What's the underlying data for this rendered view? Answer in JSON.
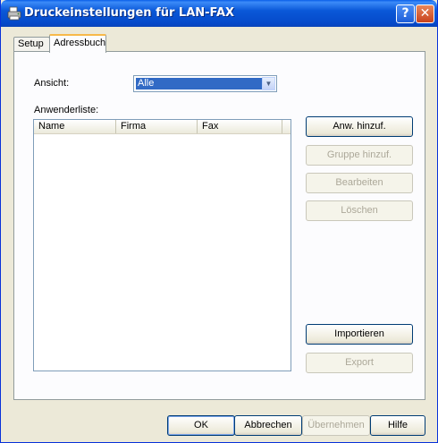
{
  "window": {
    "title": "Druckeinstellungen für LAN-FAX",
    "help_label": "?",
    "close_label": "✕"
  },
  "tabs": [
    {
      "label": "Setup"
    },
    {
      "label": "Adressbuch"
    }
  ],
  "view": {
    "label": "Ansicht:",
    "selected": "Alle"
  },
  "userlist": {
    "label": "Anwenderliste:",
    "columns": [
      "Name",
      "Firma",
      "Fax"
    ]
  },
  "actions": {
    "add_user": "Anw. hinzuf.",
    "add_group": "Gruppe hinzuf.",
    "edit": "Bearbeiten",
    "delete": "Löschen",
    "import": "Importieren",
    "export": "Export"
  },
  "footer": {
    "ok": "OK",
    "cancel": "Abbrechen",
    "apply": "Übernehmen",
    "help": "Hilfe"
  },
  "colors": {
    "titlebar": "#0a58d8",
    "selection": "#316ac5",
    "dialog_bg": "#ece9d8"
  },
  "icons": {
    "title": "fax-printer-icon",
    "combo": "chevron-down-icon"
  }
}
